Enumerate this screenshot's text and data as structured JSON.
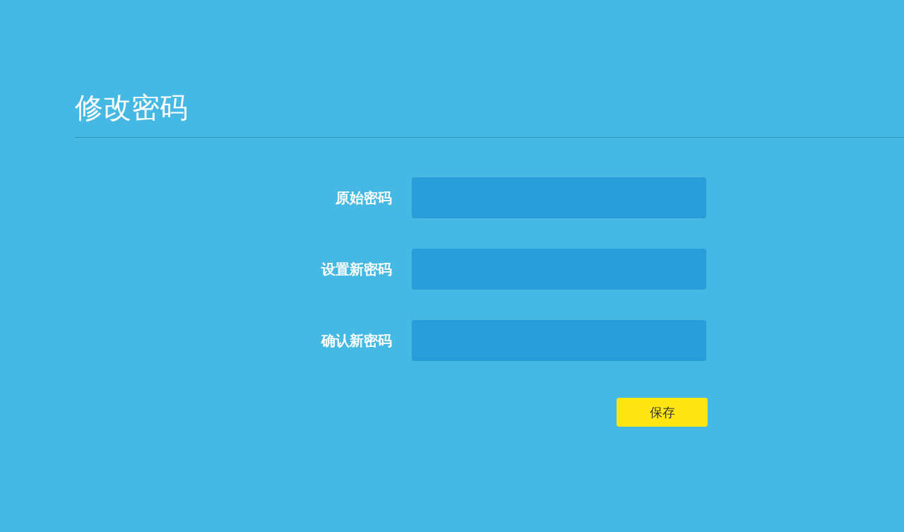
{
  "title": "修改密码",
  "fields": [
    {
      "label": "原始密码"
    },
    {
      "label": "设置新密码"
    },
    {
      "label": "确认新密码"
    }
  ],
  "save_button": "保存"
}
